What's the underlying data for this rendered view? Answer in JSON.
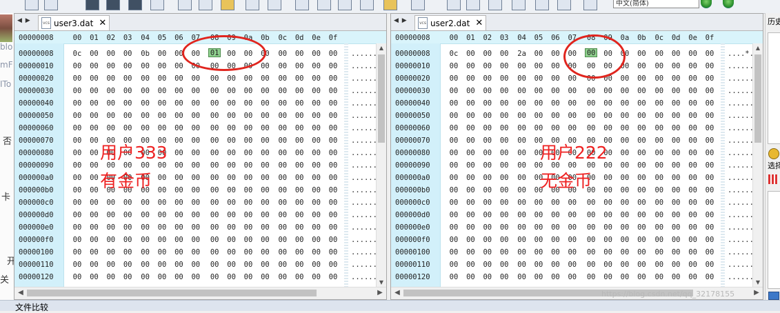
{
  "toolbar": {
    "language_select": "中文(简体)"
  },
  "left_strip": {
    "labels": [
      "blo",
      "mF",
      "ITo",
      "否",
      "卡",
      "开",
      "关"
    ]
  },
  "right_panel": {
    "history_title": "历史",
    "options_title": "选择"
  },
  "status": {
    "text": "文件比较"
  },
  "watermark": "https://blog.csdn.net/qq_32178155",
  "left_pane": {
    "tab_label": "user3.dat",
    "header_offset": "00000008",
    "columns": [
      "00",
      "01",
      "02",
      "03",
      "04",
      "05",
      "06",
      "07",
      "08",
      "09",
      "0a",
      "0b",
      "0c",
      "0d",
      "0e",
      "0f"
    ],
    "rows": [
      {
        "offset": "00000008",
        "bytes": [
          "0c",
          "00",
          "00",
          "00",
          "0b",
          "00",
          "00",
          "00",
          "01",
          "00",
          "00",
          "00",
          "00",
          "00",
          "00",
          "00"
        ],
        "ascii": "......"
      },
      {
        "offset": "00000010",
        "bytes": [
          "00",
          "00",
          "00",
          "00",
          "00",
          "00",
          "00",
          "00",
          "00",
          "00",
          "00",
          "00",
          "00",
          "00",
          "00",
          "00"
        ],
        "ascii": "......"
      },
      {
        "offset": "00000020",
        "bytes": [
          "00",
          "00",
          "00",
          "00",
          "00",
          "00",
          "00",
          "00",
          "00",
          "00",
          "00",
          "00",
          "00",
          "00",
          "00",
          "00"
        ],
        "ascii": "......"
      },
      {
        "offset": "00000030",
        "bytes": [
          "00",
          "00",
          "00",
          "00",
          "00",
          "00",
          "00",
          "00",
          "00",
          "00",
          "00",
          "00",
          "00",
          "00",
          "00",
          "00"
        ],
        "ascii": "......"
      },
      {
        "offset": "00000040",
        "bytes": [
          "00",
          "00",
          "00",
          "00",
          "00",
          "00",
          "00",
          "00",
          "00",
          "00",
          "00",
          "00",
          "00",
          "00",
          "00",
          "00"
        ],
        "ascii": "......"
      },
      {
        "offset": "00000050",
        "bytes": [
          "00",
          "00",
          "00",
          "00",
          "00",
          "00",
          "00",
          "00",
          "00",
          "00",
          "00",
          "00",
          "00",
          "00",
          "00",
          "00"
        ],
        "ascii": "......"
      },
      {
        "offset": "00000060",
        "bytes": [
          "00",
          "00",
          "00",
          "00",
          "00",
          "00",
          "00",
          "00",
          "00",
          "00",
          "00",
          "00",
          "00",
          "00",
          "00",
          "00"
        ],
        "ascii": "......"
      },
      {
        "offset": "00000070",
        "bytes": [
          "00",
          "00",
          "00",
          "00",
          "00",
          "00",
          "00",
          "00",
          "00",
          "00",
          "00",
          "00",
          "00",
          "00",
          "00",
          "00"
        ],
        "ascii": "......"
      },
      {
        "offset": "00000080",
        "bytes": [
          "00",
          "00",
          "00",
          "00",
          "00",
          "00",
          "00",
          "00",
          "00",
          "00",
          "00",
          "00",
          "00",
          "00",
          "00",
          "00"
        ],
        "ascii": "......"
      },
      {
        "offset": "00000090",
        "bytes": [
          "00",
          "00",
          "00",
          "00",
          "00",
          "00",
          "00",
          "00",
          "00",
          "00",
          "00",
          "00",
          "00",
          "00",
          "00",
          "00"
        ],
        "ascii": "......"
      },
      {
        "offset": "000000a0",
        "bytes": [
          "00",
          "00",
          "00",
          "00",
          "00",
          "00",
          "00",
          "00",
          "00",
          "00",
          "00",
          "00",
          "00",
          "00",
          "00",
          "00"
        ],
        "ascii": "......"
      },
      {
        "offset": "000000b0",
        "bytes": [
          "00",
          "00",
          "00",
          "00",
          "00",
          "00",
          "00",
          "00",
          "00",
          "00",
          "00",
          "00",
          "00",
          "00",
          "00",
          "00"
        ],
        "ascii": "......"
      },
      {
        "offset": "000000c0",
        "bytes": [
          "00",
          "00",
          "00",
          "00",
          "00",
          "00",
          "00",
          "00",
          "00",
          "00",
          "00",
          "00",
          "00",
          "00",
          "00",
          "00"
        ],
        "ascii": "......"
      },
      {
        "offset": "000000d0",
        "bytes": [
          "00",
          "00",
          "00",
          "00",
          "00",
          "00",
          "00",
          "00",
          "00",
          "00",
          "00",
          "00",
          "00",
          "00",
          "00",
          "00"
        ],
        "ascii": "......"
      },
      {
        "offset": "000000e0",
        "bytes": [
          "00",
          "00",
          "00",
          "00",
          "00",
          "00",
          "00",
          "00",
          "00",
          "00",
          "00",
          "00",
          "00",
          "00",
          "00",
          "00"
        ],
        "ascii": "......"
      },
      {
        "offset": "000000f0",
        "bytes": [
          "00",
          "00",
          "00",
          "00",
          "00",
          "00",
          "00",
          "00",
          "00",
          "00",
          "00",
          "00",
          "00",
          "00",
          "00",
          "00"
        ],
        "ascii": "......"
      },
      {
        "offset": "00000100",
        "bytes": [
          "00",
          "00",
          "00",
          "00",
          "00",
          "00",
          "00",
          "00",
          "00",
          "00",
          "00",
          "00",
          "00",
          "00",
          "00",
          "00"
        ],
        "ascii": "......"
      },
      {
        "offset": "00000110",
        "bytes": [
          "00",
          "00",
          "00",
          "00",
          "00",
          "00",
          "00",
          "00",
          "00",
          "00",
          "00",
          "00",
          "00",
          "00",
          "00",
          "00"
        ],
        "ascii": "......"
      },
      {
        "offset": "00000120",
        "bytes": [
          "00",
          "00",
          "00",
          "00",
          "00",
          "00",
          "00",
          "00",
          "00",
          "00",
          "00",
          "00",
          "00",
          "00",
          "00",
          "00"
        ],
        "ascii": "......"
      }
    ],
    "highlight": {
      "row": 0,
      "col": 8
    },
    "annotation_line1": "用户333",
    "annotation_line2": "有金币"
  },
  "right_pane": {
    "tab_label": "user2.dat",
    "header_offset": "00000008",
    "columns": [
      "00",
      "01",
      "02",
      "03",
      "04",
      "05",
      "06",
      "07",
      "08",
      "09",
      "0a",
      "0b",
      "0c",
      "0d",
      "0e",
      "0f"
    ],
    "rows": [
      {
        "offset": "00000008",
        "bytes": [
          "0c",
          "00",
          "00",
          "00",
          "2a",
          "00",
          "00",
          "00",
          "00",
          "00",
          "00",
          "00",
          "00",
          "00",
          "00",
          "00"
        ],
        "ascii": "....*."
      },
      {
        "offset": "00000010",
        "bytes": [
          "00",
          "00",
          "00",
          "00",
          "00",
          "00",
          "00",
          "00",
          "00",
          "00",
          "00",
          "00",
          "00",
          "00",
          "00",
          "00"
        ],
        "ascii": "......"
      },
      {
        "offset": "00000020",
        "bytes": [
          "00",
          "00",
          "00",
          "00",
          "00",
          "00",
          "00",
          "00",
          "00",
          "00",
          "00",
          "00",
          "00",
          "00",
          "00",
          "00"
        ],
        "ascii": "......"
      },
      {
        "offset": "00000030",
        "bytes": [
          "00",
          "00",
          "00",
          "00",
          "00",
          "00",
          "00",
          "00",
          "00",
          "00",
          "00",
          "00",
          "00",
          "00",
          "00",
          "00"
        ],
        "ascii": "......"
      },
      {
        "offset": "00000040",
        "bytes": [
          "00",
          "00",
          "00",
          "00",
          "00",
          "00",
          "00",
          "00",
          "00",
          "00",
          "00",
          "00",
          "00",
          "00",
          "00",
          "00"
        ],
        "ascii": "......"
      },
      {
        "offset": "00000050",
        "bytes": [
          "00",
          "00",
          "00",
          "00",
          "00",
          "00",
          "00",
          "00",
          "00",
          "00",
          "00",
          "00",
          "00",
          "00",
          "00",
          "00"
        ],
        "ascii": "......"
      },
      {
        "offset": "00000060",
        "bytes": [
          "00",
          "00",
          "00",
          "00",
          "00",
          "00",
          "00",
          "00",
          "00",
          "00",
          "00",
          "00",
          "00",
          "00",
          "00",
          "00"
        ],
        "ascii": "......"
      },
      {
        "offset": "00000070",
        "bytes": [
          "00",
          "00",
          "00",
          "00",
          "00",
          "00",
          "00",
          "00",
          "00",
          "00",
          "00",
          "00",
          "00",
          "00",
          "00",
          "00"
        ],
        "ascii": "......"
      },
      {
        "offset": "00000080",
        "bytes": [
          "00",
          "00",
          "00",
          "00",
          "00",
          "00",
          "00",
          "00",
          "00",
          "00",
          "00",
          "00",
          "00",
          "00",
          "00",
          "00"
        ],
        "ascii": "......"
      },
      {
        "offset": "00000090",
        "bytes": [
          "00",
          "00",
          "00",
          "00",
          "00",
          "00",
          "00",
          "00",
          "00",
          "00",
          "00",
          "00",
          "00",
          "00",
          "00",
          "00"
        ],
        "ascii": "......"
      },
      {
        "offset": "000000a0",
        "bytes": [
          "00",
          "00",
          "00",
          "00",
          "00",
          "00",
          "00",
          "00",
          "00",
          "00",
          "00",
          "00",
          "00",
          "00",
          "00",
          "00"
        ],
        "ascii": "......"
      },
      {
        "offset": "000000b0",
        "bytes": [
          "00",
          "00",
          "00",
          "00",
          "00",
          "00",
          "00",
          "00",
          "00",
          "00",
          "00",
          "00",
          "00",
          "00",
          "00",
          "00"
        ],
        "ascii": "......"
      },
      {
        "offset": "000000c0",
        "bytes": [
          "00",
          "00",
          "00",
          "00",
          "00",
          "00",
          "00",
          "00",
          "00",
          "00",
          "00",
          "00",
          "00",
          "00",
          "00",
          "00"
        ],
        "ascii": "......"
      },
      {
        "offset": "000000d0",
        "bytes": [
          "00",
          "00",
          "00",
          "00",
          "00",
          "00",
          "00",
          "00",
          "00",
          "00",
          "00",
          "00",
          "00",
          "00",
          "00",
          "00"
        ],
        "ascii": "......"
      },
      {
        "offset": "000000e0",
        "bytes": [
          "00",
          "00",
          "00",
          "00",
          "00",
          "00",
          "00",
          "00",
          "00",
          "00",
          "00",
          "00",
          "00",
          "00",
          "00",
          "00"
        ],
        "ascii": "......"
      },
      {
        "offset": "000000f0",
        "bytes": [
          "00",
          "00",
          "00",
          "00",
          "00",
          "00",
          "00",
          "00",
          "00",
          "00",
          "00",
          "00",
          "00",
          "00",
          "00",
          "00"
        ],
        "ascii": "......"
      },
      {
        "offset": "00000100",
        "bytes": [
          "00",
          "00",
          "00",
          "00",
          "00",
          "00",
          "00",
          "00",
          "00",
          "00",
          "00",
          "00",
          "00",
          "00",
          "00",
          "00"
        ],
        "ascii": "......"
      },
      {
        "offset": "00000110",
        "bytes": [
          "00",
          "00",
          "00",
          "00",
          "00",
          "00",
          "00",
          "00",
          "00",
          "00",
          "00",
          "00",
          "00",
          "00",
          "00",
          "00"
        ],
        "ascii": "......"
      },
      {
        "offset": "00000120",
        "bytes": [
          "00",
          "00",
          "00",
          "00",
          "00",
          "00",
          "00",
          "00",
          "00",
          "00",
          "00",
          "00",
          "00",
          "00",
          "00",
          "00"
        ],
        "ascii": "......"
      }
    ],
    "highlight": {
      "row": 0,
      "col": 8
    },
    "annotation_line1": "用户222",
    "annotation_line2": "无金币"
  }
}
